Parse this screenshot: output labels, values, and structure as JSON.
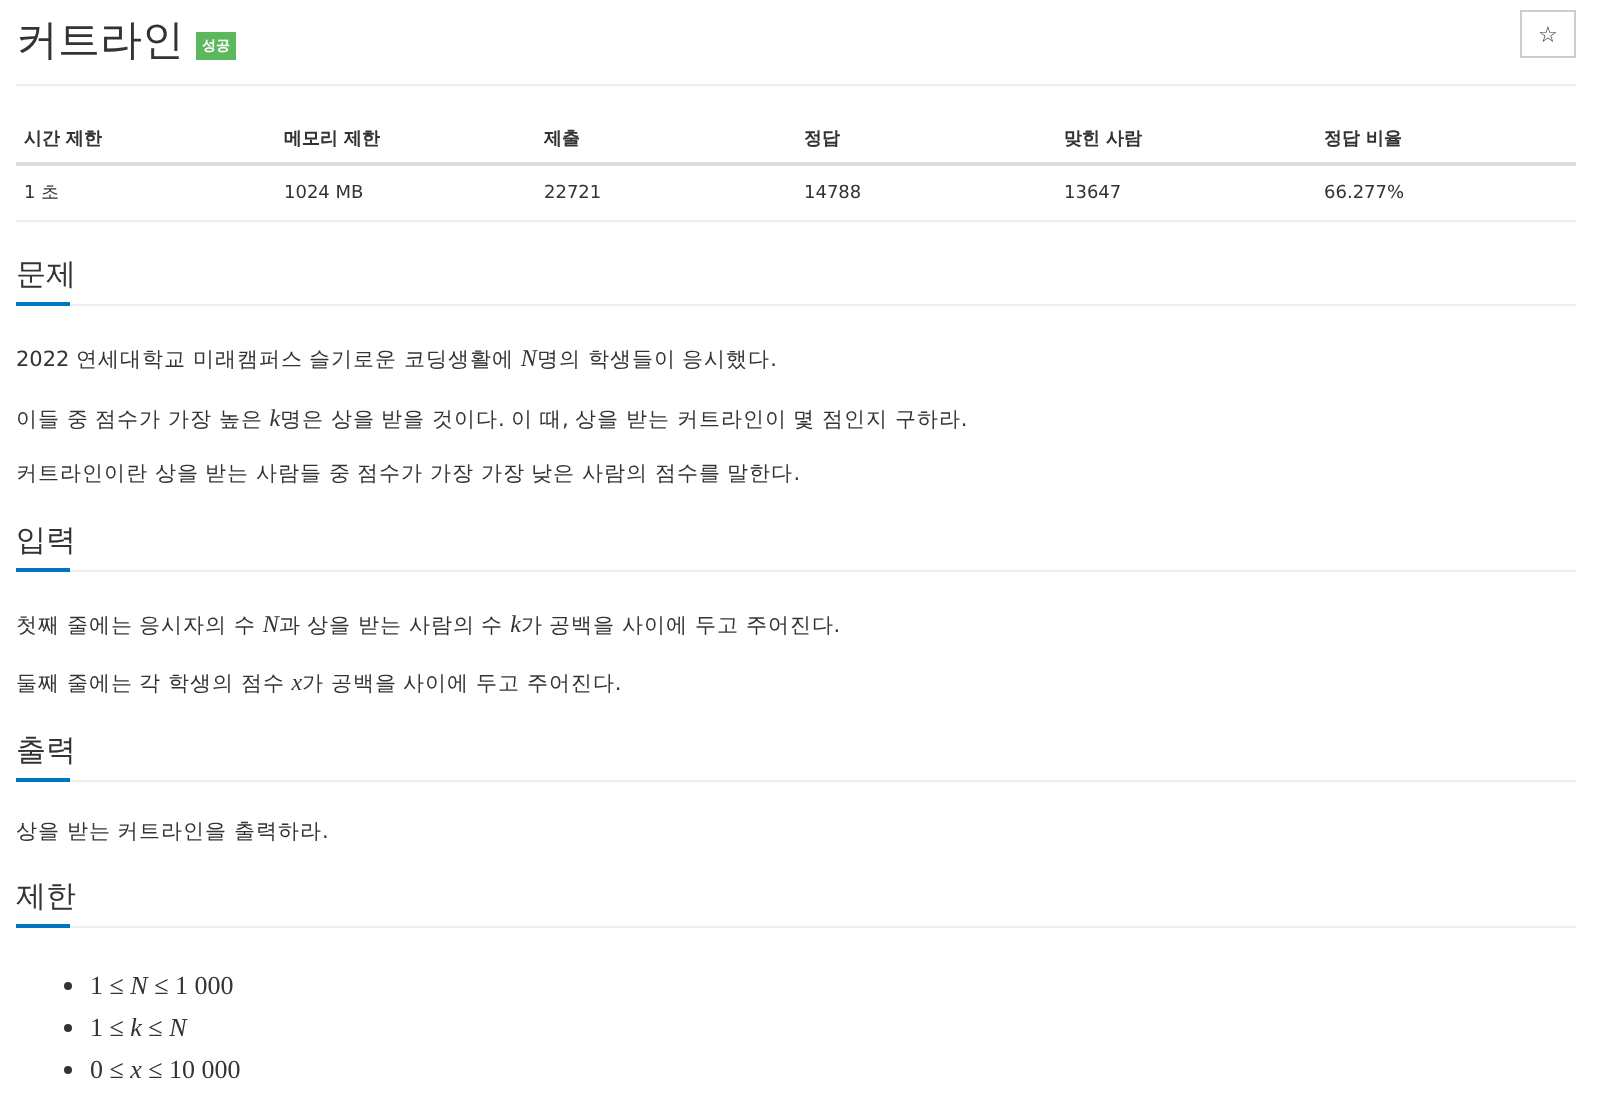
{
  "title": "커트라인",
  "badge": "성공",
  "star_button": "☆",
  "table": {
    "columns": [
      "시간 제한",
      "메모리 제한",
      "제출",
      "정답",
      "맞힌 사람",
      "정답 비율"
    ],
    "rows": [
      [
        "1 초",
        "1024 MB",
        "22721",
        "14788",
        "13647",
        "66.277%"
      ]
    ]
  },
  "sections": [
    {
      "title": "문제",
      "kind": "paragraphs",
      "paragraphs": [
        [
          {
            "text": "2022 연세대학교 미래캠퍼스 슬기로운 코딩생활에 ",
            "math": false
          },
          {
            "text": "N",
            "math": true
          },
          {
            "text": "명의 학생들이 응시했다.",
            "math": false
          }
        ],
        [
          {
            "text": "이들 중 점수가 가장 높은 ",
            "math": false
          },
          {
            "text": "k",
            "math": true
          },
          {
            "text": "명은 상을 받을 것이다. 이 때, 상을 받는 커트라인이 몇 점인지 구하라.",
            "math": false
          }
        ],
        [
          {
            "text": "커트라인이란 상을 받는 사람들 중 점수가 가장 가장 낮은 사람의 점수를 말한다.",
            "math": false
          }
        ]
      ]
    },
    {
      "title": "입력",
      "kind": "paragraphs",
      "paragraphs": [
        [
          {
            "text": "첫째 줄에는 응시자의 수 ",
            "math": false
          },
          {
            "text": "N",
            "math": true
          },
          {
            "text": "과 상을 받는 사람의 수 ",
            "math": false
          },
          {
            "text": "k",
            "math": true
          },
          {
            "text": "가 공백을 사이에 두고 주어진다.",
            "math": false
          }
        ],
        [
          {
            "text": "둘째 줄에는 각 학생의 점수 ",
            "math": false
          },
          {
            "text": "x",
            "math": true
          },
          {
            "text": "가 공백을 사이에 두고 주어진다.",
            "math": false
          }
        ]
      ]
    },
    {
      "title": "출력",
      "kind": "paragraphs",
      "paragraphs": [
        [
          {
            "text": "상을 받는 커트라인을 출력하라.",
            "math": false
          }
        ]
      ]
    },
    {
      "title": "제한",
      "kind": "list",
      "items": [
        "1 ≤ *N* ≤ 1 000",
        "1 ≤ *k* ≤ *N*",
        "0 ≤ *x* ≤ 10 000"
      ]
    }
  ]
}
